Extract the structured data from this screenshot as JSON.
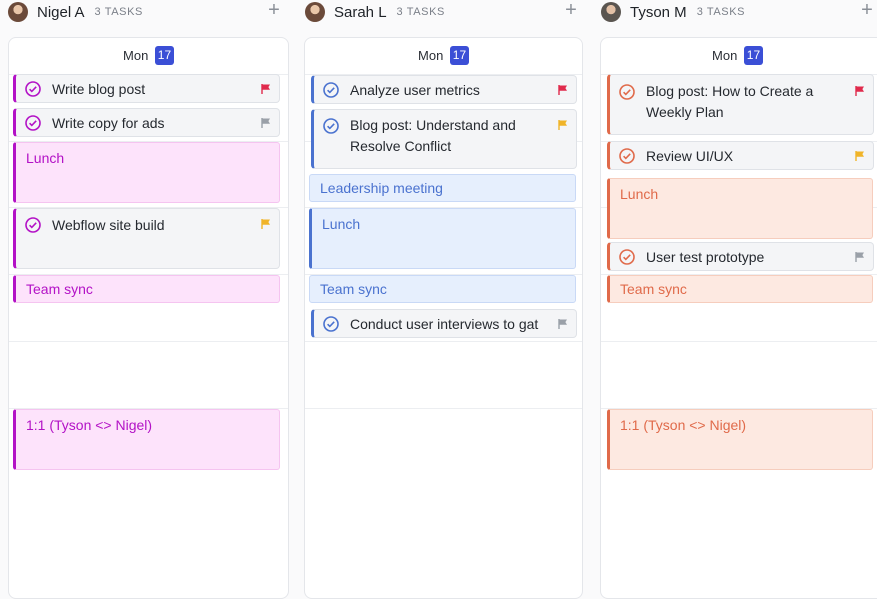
{
  "columns": [
    {
      "name": "Nigel A",
      "count": "3 TASKS",
      "day": "Mon",
      "date": "17",
      "items": [
        {
          "kind": "task",
          "title": "Write blog post",
          "flag": "red"
        },
        {
          "kind": "task",
          "title": "Write copy for ads",
          "flag": "gray"
        },
        {
          "kind": "event",
          "title": "Lunch"
        },
        {
          "kind": "task",
          "title": "Webflow site build",
          "flag": "yellow"
        },
        {
          "kind": "event",
          "title": "Team sync"
        },
        {
          "kind": "event",
          "title": "1:1 (Tyson <> Nigel)"
        }
      ]
    },
    {
      "name": "Sarah L",
      "count": "3 TASKS",
      "day": "Mon",
      "date": "17",
      "items": [
        {
          "kind": "task",
          "title": "Analyze user metrics",
          "flag": "red"
        },
        {
          "kind": "task",
          "title": "Blog post: Understand and Resolve Conflict",
          "flag": "yellow"
        },
        {
          "kind": "event",
          "title": "Leadership meeting"
        },
        {
          "kind": "event",
          "title": "Lunch"
        },
        {
          "kind": "event",
          "title": "Team sync"
        },
        {
          "kind": "task",
          "title": "Conduct user interviews to gat",
          "flag": "gray"
        }
      ]
    },
    {
      "name": "Tyson M",
      "count": "3 TASKS",
      "day": "Mon",
      "date": "17",
      "items": [
        {
          "kind": "task",
          "title": "Blog post: How to Create a Weekly Plan",
          "flag": "red"
        },
        {
          "kind": "task",
          "title": "Review UI/UX",
          "flag": "yellow"
        },
        {
          "kind": "event",
          "title": "Lunch"
        },
        {
          "kind": "task",
          "title": "User test prototype",
          "flag": "gray"
        },
        {
          "kind": "event",
          "title": "Team sync"
        },
        {
          "kind": "event",
          "title": "1:1 (Tyson <> Nigel)"
        }
      ]
    }
  ],
  "colors": {
    "nigel_accent": "#b312c6",
    "nigel_event_bg": "#fde3fb",
    "sarah_accent": "#4a72cf",
    "sarah_event_bg": "#e6effd",
    "tyson_accent": "#e06a4a",
    "tyson_event_bg": "#fde9e1",
    "flag_red": "#e02a4c",
    "flag_yellow": "#f0b429",
    "flag_gray": "#9aa0a8",
    "date_badge": "#3b4fd6"
  }
}
